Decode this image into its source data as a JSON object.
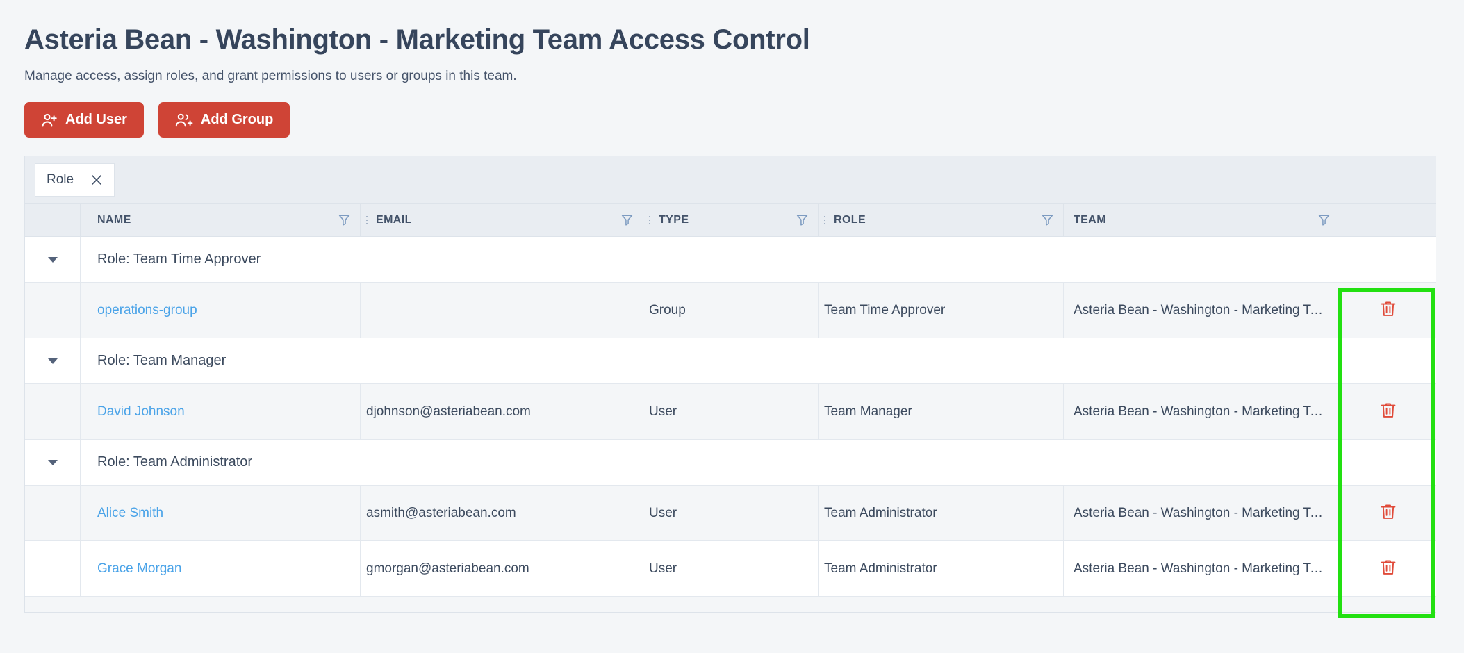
{
  "header": {
    "title": "Asteria Bean - Washington - Marketing Team Access Control",
    "subtitle": "Manage access, assign roles, and grant permissions to users or groups in this team."
  },
  "toolbar": {
    "add_user_label": "Add User",
    "add_user_icon": "person-plus-icon",
    "add_group_label": "Add Group",
    "add_group_icon": "people-plus-icon",
    "button_color": "#cf4436"
  },
  "group_bar": {
    "chips": [
      {
        "label": "Role",
        "close_icon": "close-icon"
      }
    ]
  },
  "table": {
    "columns": [
      {
        "key": "expander",
        "label": ""
      },
      {
        "key": "name",
        "label": "NAME",
        "filter_icon": "filter-funnel-icon"
      },
      {
        "key": "email",
        "label": "EMAIL",
        "filter_icon": "filter-funnel-icon"
      },
      {
        "key": "type",
        "label": "TYPE",
        "filter_icon": "filter-funnel-icon"
      },
      {
        "key": "role",
        "label": "ROLE",
        "filter_icon": "filter-funnel-icon"
      },
      {
        "key": "team",
        "label": "TEAM",
        "filter_icon": "filter-funnel-icon"
      },
      {
        "key": "actions",
        "label": ""
      }
    ],
    "groups": [
      {
        "label": "Role: Team Time Approver",
        "expanded": true,
        "rows": [
          {
            "name": "operations-group",
            "email": "",
            "type": "Group",
            "role": "Team Time Approver",
            "team": "Asteria Bean - Washington - Marketing Te…",
            "delete_icon": "trash-icon"
          }
        ]
      },
      {
        "label": "Role: Team Manager",
        "expanded": true,
        "rows": [
          {
            "name": "David Johnson",
            "email": "djohnson@asteriabean.com",
            "type": "User",
            "role": "Team Manager",
            "team": "Asteria Bean - Washington - Marketing Te…",
            "delete_icon": "trash-icon"
          }
        ]
      },
      {
        "label": "Role: Team Administrator",
        "expanded": true,
        "rows": [
          {
            "name": "Alice Smith",
            "email": "asmith@asteriabean.com",
            "type": "User",
            "role": "Team Administrator",
            "team": "Asteria Bean - Washington - Marketing Te…",
            "delete_icon": "trash-icon"
          },
          {
            "name": "Grace Morgan",
            "email": "gmorgan@asteriabean.com",
            "type": "User",
            "role": "Team Administrator",
            "team": "Asteria Bean - Washington - Marketing Te…",
            "delete_icon": "trash-icon"
          }
        ]
      }
    ]
  },
  "annotation": {
    "shape": "rectangle",
    "color": "#22e011",
    "target": "delete-actions-column"
  }
}
